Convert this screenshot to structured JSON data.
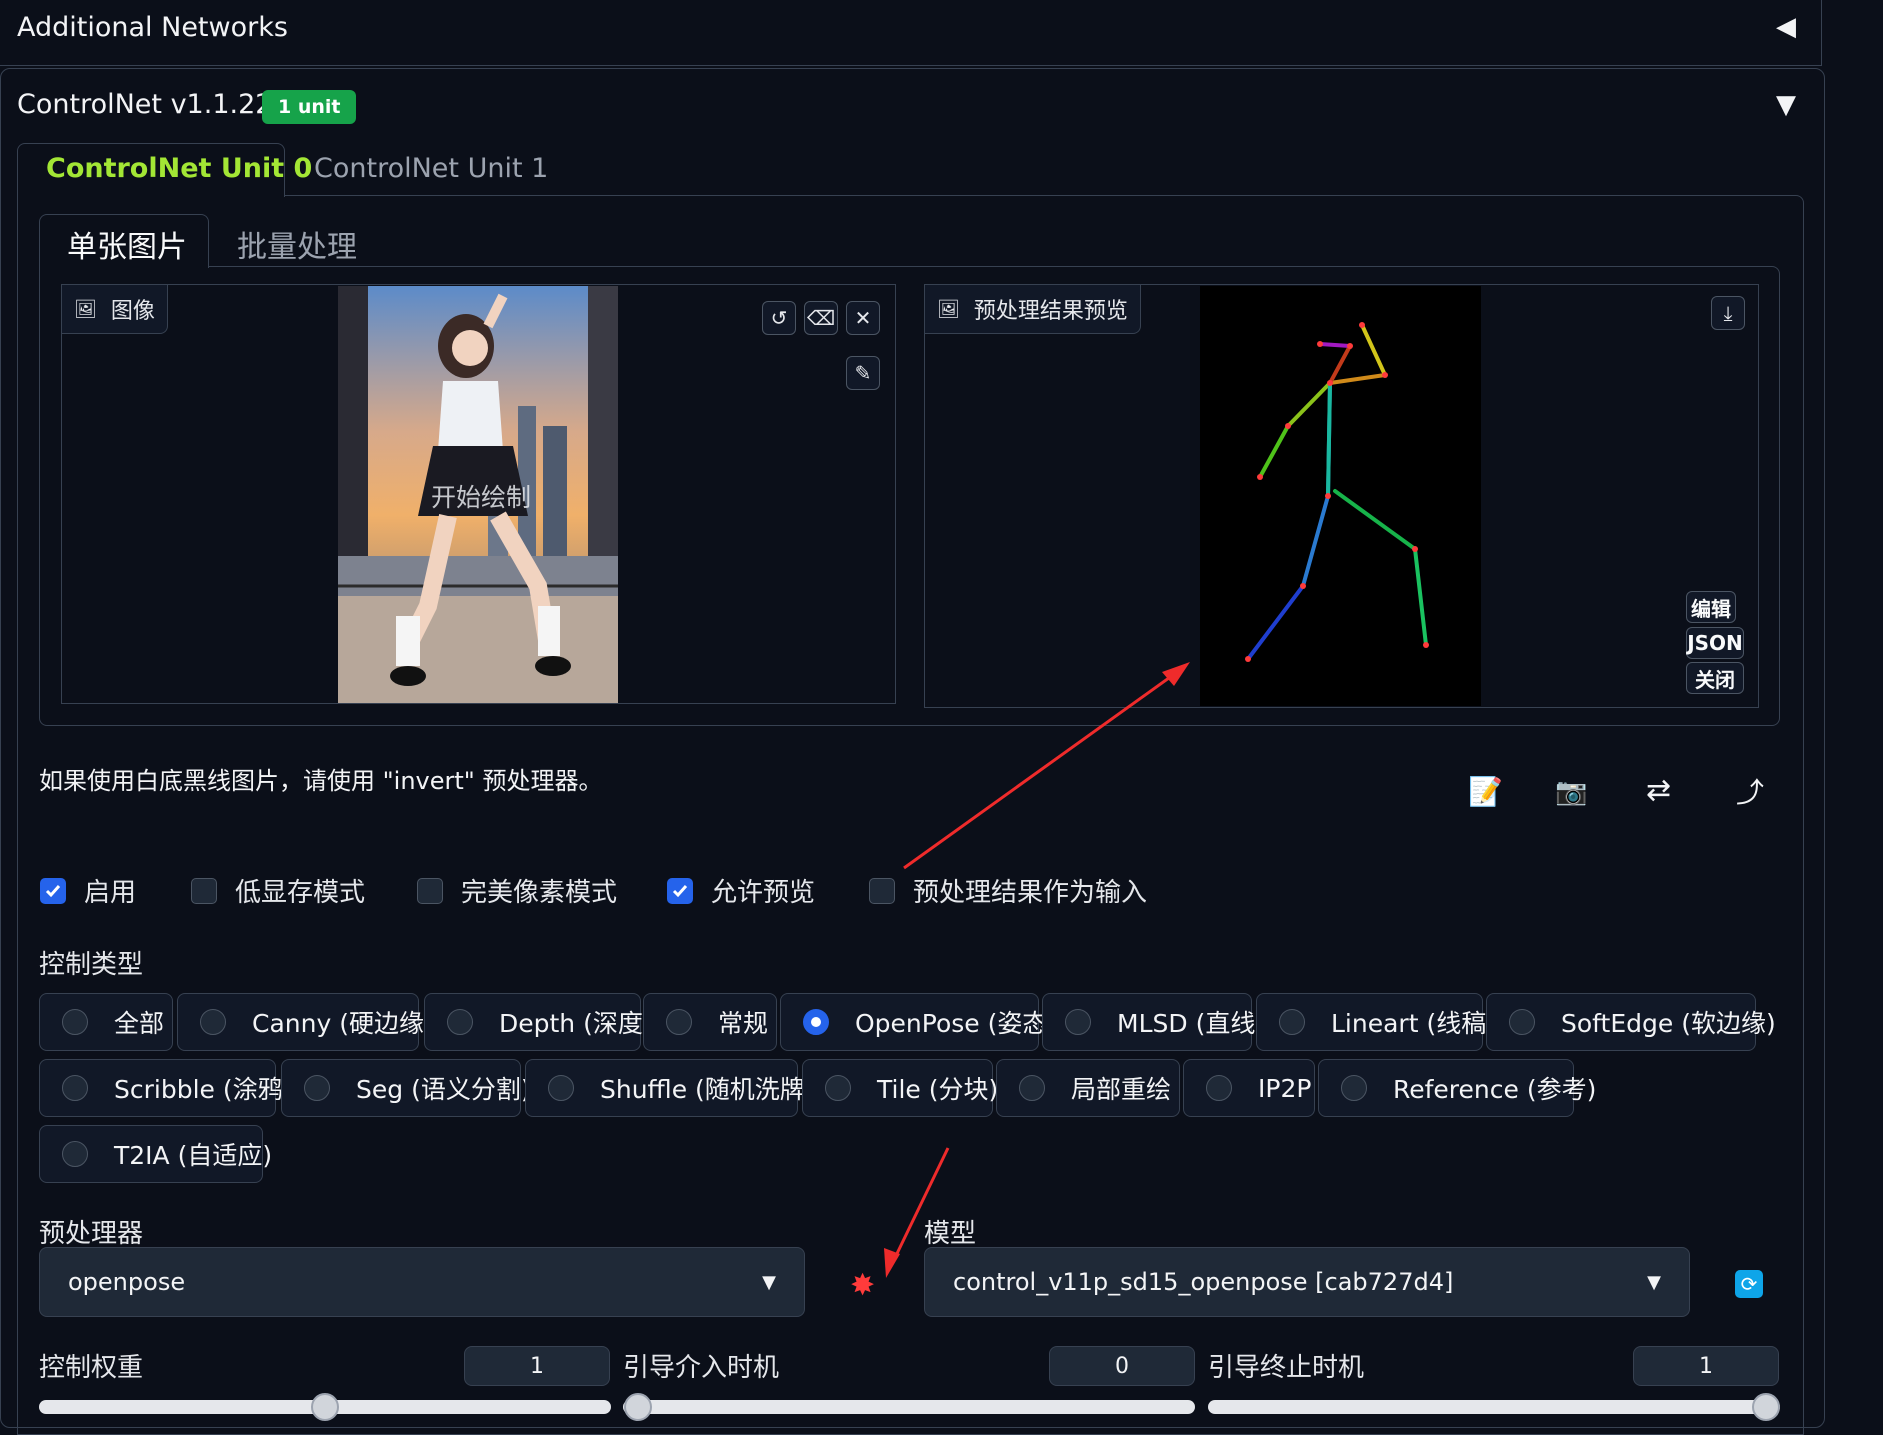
{
  "accordions": {
    "additional_networks": {
      "title": "Additional Networks",
      "toggle": "◀"
    },
    "controlnet": {
      "title": "ControlNet v1.1.227",
      "badge": "1 unit",
      "toggle": "▼"
    }
  },
  "unit_tabs": [
    {
      "label": "ControlNet Unit 0",
      "active": true
    },
    {
      "label": "ControlNet Unit 1",
      "active": false
    }
  ],
  "mode_tabs": [
    {
      "label": "单张图片",
      "active": true
    },
    {
      "label": "批量处理",
      "active": false
    }
  ],
  "image_panel": {
    "label": "图像",
    "overlay_text": "开始绘制",
    "tools": [
      "undo-icon",
      "eraser-icon",
      "close-icon",
      "brush-icon"
    ]
  },
  "preview_panel": {
    "label": "预处理结果预览",
    "tools": [
      "download-icon"
    ],
    "side_buttons": [
      "编辑",
      "JSON",
      "关闭"
    ]
  },
  "hint": "如果使用白底黑线图片，请使用 \"invert\" 预处理器。",
  "action_icons": [
    "new-canvas-icon",
    "camera-icon",
    "swap-icon",
    "send-dimensions-icon"
  ],
  "checkboxes": [
    {
      "label": "启用",
      "checked": true
    },
    {
      "label": "低显存模式",
      "checked": false
    },
    {
      "label": "完美像素模式",
      "checked": false
    },
    {
      "label": "允许预览",
      "checked": true
    },
    {
      "label": "预处理结果作为输入",
      "checked": false
    }
  ],
  "control_type": {
    "label": "控制类型",
    "options": [
      {
        "label": "全部",
        "selected": false
      },
      {
        "label": "Canny (硬边缘)",
        "selected": false
      },
      {
        "label": "Depth (深度)",
        "selected": false
      },
      {
        "label": "常规",
        "selected": false
      },
      {
        "label": "OpenPose (姿态)",
        "selected": true
      },
      {
        "label": "MLSD (直线)",
        "selected": false
      },
      {
        "label": "Lineart (线稿)",
        "selected": false
      },
      {
        "label": "SoftEdge (软边缘)",
        "selected": false
      },
      {
        "label": "Scribble (涂鸦)",
        "selected": false
      },
      {
        "label": "Seg (语义分割)",
        "selected": false
      },
      {
        "label": "Shuffle (随机洗牌)",
        "selected": false
      },
      {
        "label": "Tile (分块)",
        "selected": false
      },
      {
        "label": "局部重绘",
        "selected": false
      },
      {
        "label": "IP2P",
        "selected": false
      },
      {
        "label": "Reference (参考)",
        "selected": false
      },
      {
        "label": "T2IA (自适应)",
        "selected": false
      }
    ]
  },
  "preprocessor": {
    "label": "预处理器",
    "value": "openpose"
  },
  "model": {
    "label": "模型",
    "value": "control_v11p_sd15_openpose [cab727d4]"
  },
  "run_icon": "explosion-icon",
  "refresh_icon": "refresh-icon",
  "sliders": [
    {
      "label": "控制权重",
      "value": "1",
      "fraction": 0.5
    },
    {
      "label": "引导介入时机",
      "value": "0",
      "fraction": 0.0
    },
    {
      "label": "引导终止时机",
      "value": "1",
      "fraction": 1.0
    }
  ],
  "colors": {
    "accent_green": "#a3e635",
    "badge_green": "#16a34a",
    "checkbox_blue": "#2563eb",
    "annotation_red": "#ef2b2b"
  }
}
